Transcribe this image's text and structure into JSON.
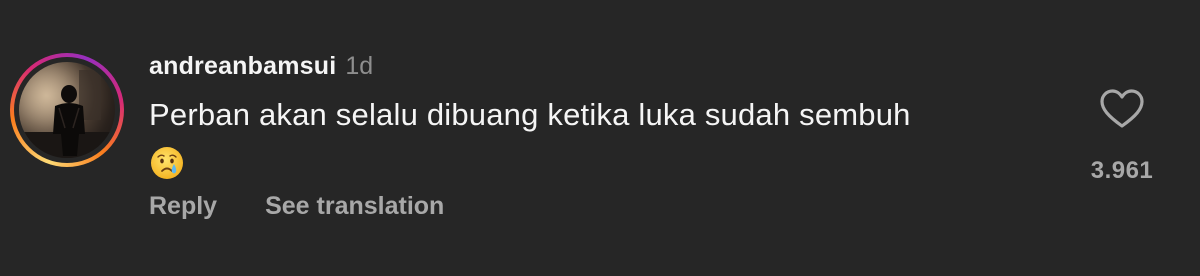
{
  "comment": {
    "username": "andreanbamsui",
    "timestamp": "1d",
    "text": "Perban akan selalu dibuang ketika luka sudah sembuh",
    "emoji": "😢",
    "like_count": "3.961",
    "actions": {
      "reply": "Reply",
      "translate": "See translation"
    }
  },
  "icons": {
    "like": "heart-outline-icon",
    "emoji": "crying-face-emoji"
  },
  "colors": {
    "background": "#262626",
    "primary_text": "#f5f5f5",
    "secondary_text": "#a8a8a8",
    "story_ring": [
      "#feda75",
      "#fa7e1e",
      "#d62976",
      "#962fbf"
    ]
  }
}
